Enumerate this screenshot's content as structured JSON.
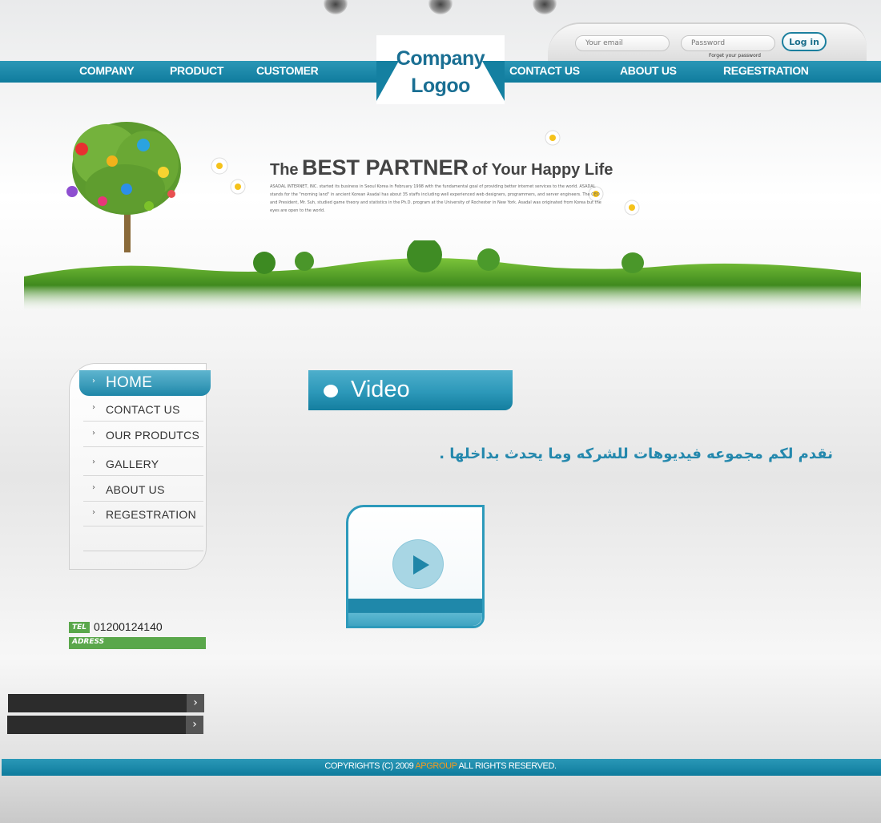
{
  "login": {
    "email_placeholder": "Your email",
    "password_placeholder": "Password",
    "button_label": "Log in",
    "forget_link": "Forget your password"
  },
  "logo": {
    "line1": "Company",
    "line2": "Logoo"
  },
  "nav": {
    "left": [
      "COMPANY",
      "PRODUCT",
      "CUSTOMER"
    ],
    "right": [
      "CONTACT US",
      "ABOUT US",
      "REGESTRATION"
    ]
  },
  "hero": {
    "the": "The",
    "best_partner": "BEST PARTNER",
    "of_your": "of Your Happy Life",
    "description": "ASADAL INTERNET, INC. started its business in Seoul Korea in February 1998 with the fundamental goal of providing better internet services to the world. ASADAL stands for the \"morning land\" in ancient Korean Asadal has about 35 staffs including well experienced web designers, programmers, and server engineers. The CEO and President, Mr. Suh, studied game theory and statistics in the Ph.D. program at the University of Rochester in New York. Asadal was originated from Korea but the eyes are open to the world."
  },
  "sidebar": {
    "items": [
      "HOME",
      "CONTACT US",
      "OUR PRODUTCS",
      "GALLERY",
      "ABOUT US",
      "REGESTRATION"
    ]
  },
  "contact": {
    "tel_label": "TEL",
    "tel_number": "01200124140",
    "address_label": "ADRESS"
  },
  "content": {
    "section_title": "Video",
    "arabic_text": "نقدم لكم مجموعه  فيديوهات للشركه وما يحدث بداخلها ."
  },
  "footer": {
    "before": "COPYRIGHTS (C) 2009 ",
    "brand": "APGROUP",
    "after": " ALL RIGHTS RESERVED."
  },
  "colors": {
    "accent": "#1480a1",
    "accent_light": "#4eafcc",
    "green": "#5aa74b",
    "brand_orange": "#f39a1f"
  },
  "icons": {
    "nav_arrow": "chevron-right-icon",
    "play": "play-icon"
  }
}
